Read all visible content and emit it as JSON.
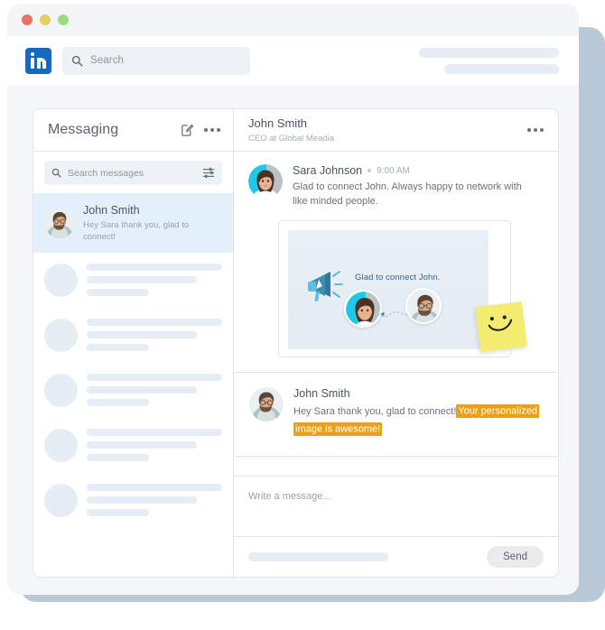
{
  "window": {
    "traffic_lights": [
      "close",
      "minimize",
      "maximize"
    ]
  },
  "nav": {
    "logo": "linkedin-logo",
    "search_placeholder": "Search",
    "search_icon": "search-icon"
  },
  "messaging": {
    "title": "Messaging",
    "compose_icon": "compose-icon",
    "more_icon": "more-options-icon",
    "search": {
      "placeholder": "Search messages",
      "icon": "search-icon",
      "filter_icon": "filter-sliders-icon"
    },
    "active_conversation": {
      "name": "John Smith",
      "snippet": "Hey Sara thank you, glad to connect!",
      "avatar": "john-smith-avatar"
    },
    "skeleton_rows": 5
  },
  "conversation": {
    "header": {
      "name": "John Smith",
      "subtitle": "CEO at Global Meadia",
      "more_icon": "more-options-icon"
    },
    "messages": [
      {
        "sender": "Sara Johnson",
        "time": "9:00 AM",
        "text": "Glad to connect John. Always happy to network with like minded people.",
        "avatar": "sara-johnson-avatar"
      }
    ],
    "attachment_card": {
      "headline": "Glad to connect John.",
      "megaphone_icon": "megaphone-icon",
      "avatar_left": "sara-johnson-avatar",
      "avatar_right": "john-smith-avatar",
      "sticky_note_icon": "smiley-face-icon"
    },
    "highlighted_message": {
      "sender": "John Smith",
      "avatar": "john-smith-avatar",
      "text_plain": "Hey Sara thank you, glad to connect!",
      "text_highlighted": "Your personalized image is awesome!",
      "highlight_color": "#e9a11c"
    },
    "composer": {
      "placeholder": "Write a message...",
      "send_label": "Send"
    }
  },
  "colors": {
    "linkedin_blue": "#1569c0",
    "active_item_bg": "#e3effb",
    "skeleton": "#e7edf5",
    "highlight": "#e9a11c",
    "sticky_note": "#f4ec71",
    "traffic_red": "#ea7068",
    "traffic_yellow": "#e6cd62",
    "traffic_green": "#9adb7c"
  }
}
